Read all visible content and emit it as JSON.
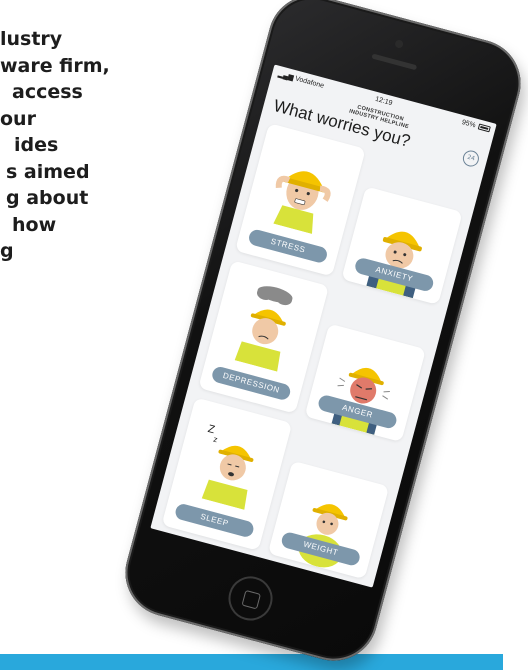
{
  "article": {
    "lines": [
      "lustry",
      "ware firm,",
      "access",
      "our",
      "ides",
      "s aimed",
      "g about",
      "how",
      "g"
    ]
  },
  "app": {
    "status": {
      "carrier": "Vodafone",
      "time": "12:19",
      "battery": "95%"
    },
    "brand_line1": "CONSTRUCTION",
    "brand_line2": "INDUSTRY HELPLINE",
    "title": "What worries you?",
    "help_label": "24",
    "cards": [
      {
        "label": "STRESS"
      },
      {
        "label": "ANXIETY"
      },
      {
        "label": "DEPRESSION"
      },
      {
        "label": "ANGER"
      },
      {
        "label": "SLEEP"
      },
      {
        "label": "WEIGHT"
      }
    ]
  },
  "colors": {
    "label_pill": "#7d97ab",
    "hard_hat": "#f5c400",
    "hi_vis_vest": "#d8e23a",
    "bottom_bar": "#29a8dc"
  },
  "icons": [
    "signal-icon",
    "wifi-icon",
    "battery-icon",
    "helpline-24-icon",
    "home-button-icon"
  ]
}
